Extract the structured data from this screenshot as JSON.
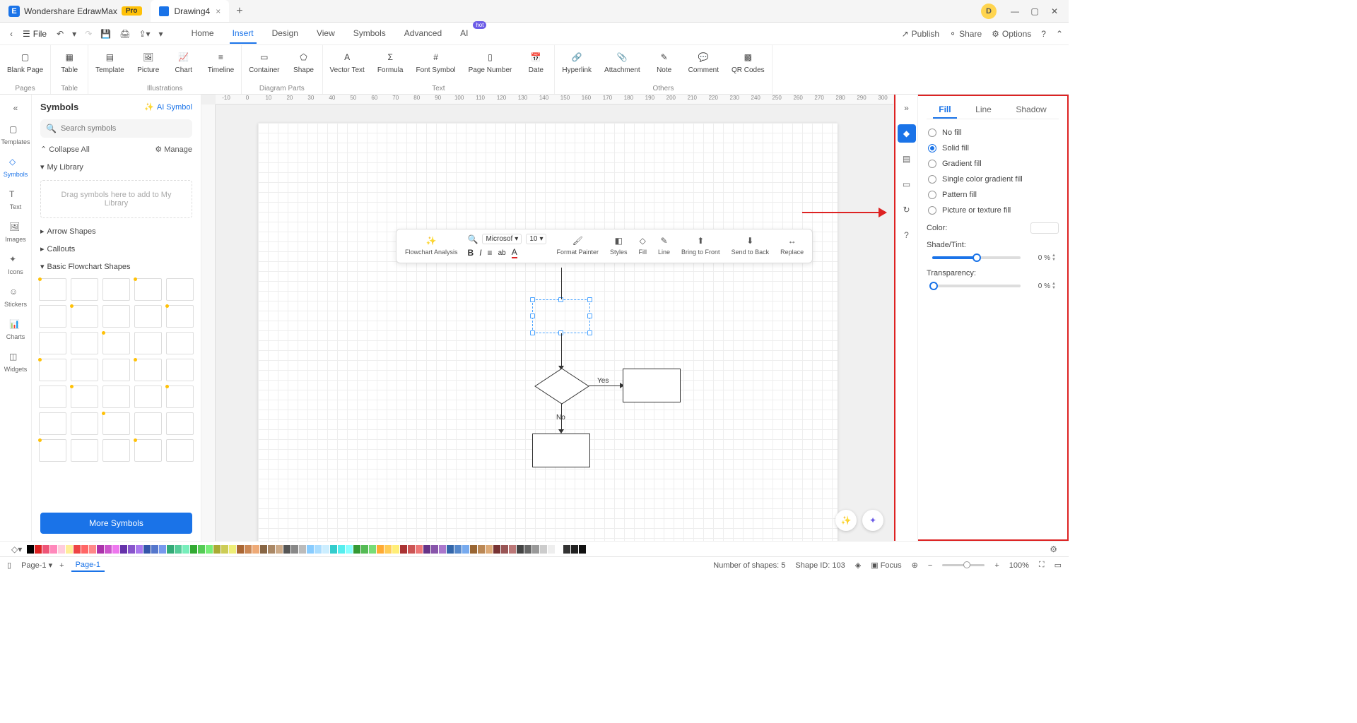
{
  "titlebar": {
    "app_name": "Wondershare EdrawMax",
    "pro_badge": "Pro",
    "doc_tab": "Drawing4",
    "user_initial": "D"
  },
  "menurow": {
    "file": "File",
    "menus": [
      "Home",
      "Insert",
      "Design",
      "View",
      "Symbols",
      "Advanced",
      "AI"
    ],
    "active": "Insert",
    "hot": "hot",
    "publish": "Publish",
    "share": "Share",
    "options": "Options"
  },
  "ribbon": {
    "groups": [
      {
        "label": "Pages",
        "items": [
          {
            "label": "Blank\nPage"
          }
        ]
      },
      {
        "label": "Table",
        "items": [
          {
            "label": "Table"
          }
        ]
      },
      {
        "label": "Illustrations",
        "items": [
          {
            "label": "Template"
          },
          {
            "label": "Picture"
          },
          {
            "label": "Chart"
          },
          {
            "label": "Timeline"
          }
        ]
      },
      {
        "label": "Diagram Parts",
        "items": [
          {
            "label": "Container"
          },
          {
            "label": "Shape"
          }
        ]
      },
      {
        "label": "Text",
        "items": [
          {
            "label": "Vector\nText"
          },
          {
            "label": "Formula"
          },
          {
            "label": "Font\nSymbol"
          },
          {
            "label": "Page\nNumber"
          },
          {
            "label": "Date"
          }
        ]
      },
      {
        "label": "Others",
        "items": [
          {
            "label": "Hyperlink"
          },
          {
            "label": "Attachment"
          },
          {
            "label": "Note"
          },
          {
            "label": "Comment"
          },
          {
            "label": "QR\nCodes"
          }
        ]
      }
    ]
  },
  "leftbar": {
    "items": [
      {
        "label": "Templates"
      },
      {
        "label": "Symbols"
      },
      {
        "label": "Text"
      },
      {
        "label": "Images"
      },
      {
        "label": "Icons"
      },
      {
        "label": "Stickers"
      },
      {
        "label": "Charts"
      },
      {
        "label": "Widgets"
      }
    ],
    "active": "Symbols"
  },
  "symbols_panel": {
    "title": "Symbols",
    "ai_symbol": "AI Symbol",
    "search_placeholder": "Search symbols",
    "collapse_all": "Collapse All",
    "manage": "Manage",
    "my_library": "My Library",
    "drop_hint": "Drag symbols here to add to My Library",
    "arrow_shapes": "Arrow Shapes",
    "callouts": "Callouts",
    "basic_flowchart": "Basic Flowchart Shapes",
    "more": "More Symbols"
  },
  "ruler_h": [
    "-10",
    "0",
    "10",
    "20",
    "30",
    "40",
    "50",
    "60",
    "70",
    "80",
    "90",
    "100",
    "110",
    "120",
    "130",
    "140",
    "150",
    "160",
    "170",
    "180",
    "190",
    "200",
    "210",
    "220",
    "230",
    "240",
    "250",
    "260",
    "270",
    "280",
    "290",
    "300"
  ],
  "float_toolbar": {
    "font": "Microsof",
    "size": "10",
    "items": [
      "Flowchart\nAnalysis",
      "Format\nPainter",
      "Styles",
      "Fill",
      "Line",
      "Bring to\nFront",
      "Send to\nBack",
      "Replace"
    ]
  },
  "flowchart": {
    "yes": "Yes",
    "no": "No"
  },
  "right_tabs": [
    "Fill",
    "Line",
    "Shadow"
  ],
  "right_active": "Fill",
  "fill_options": [
    "No fill",
    "Solid fill",
    "Gradient fill",
    "Single color gradient fill",
    "Pattern fill",
    "Picture or texture fill"
  ],
  "fill_selected": "Solid fill",
  "props": {
    "color_label": "Color:",
    "shade_label": "Shade/Tint:",
    "shade_value": "0 %",
    "transparency_label": "Transparency:",
    "transparency_value": "0 %"
  },
  "statusbar": {
    "page_select": "Page-1",
    "page_tab": "Page-1",
    "shapes": "Number of shapes: 5",
    "shape_id": "Shape ID: 103",
    "focus": "Focus",
    "zoom": "100%"
  }
}
